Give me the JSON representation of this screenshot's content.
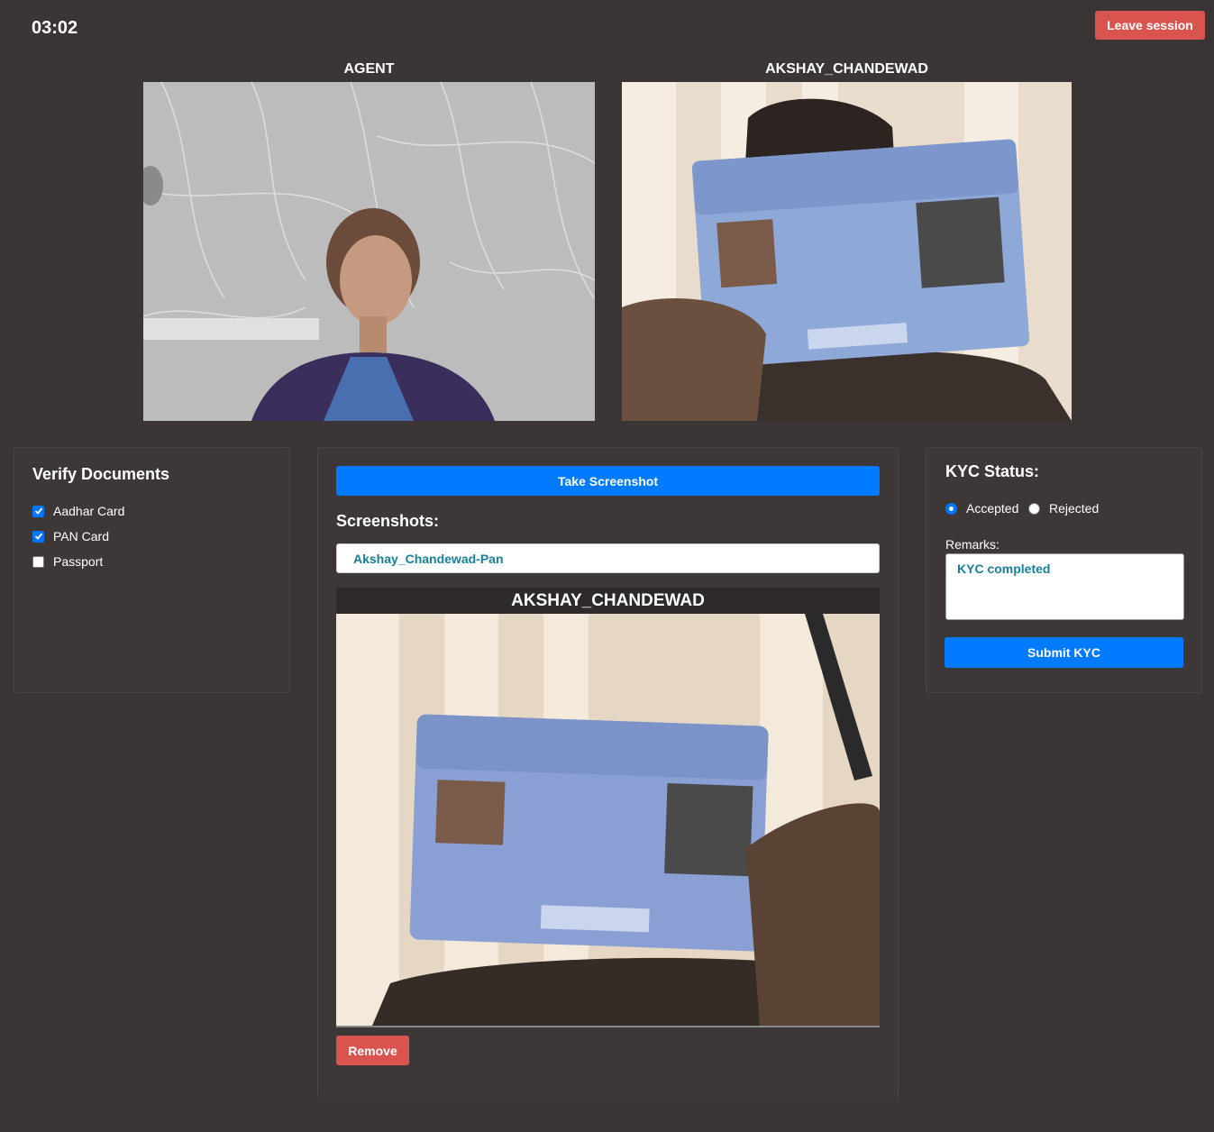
{
  "header": {
    "timer": "03:02",
    "leave_label": "Leave session"
  },
  "videos": {
    "agent_label": "AGENT",
    "customer_label": "AKSHAY_CHANDEWAD"
  },
  "verify": {
    "title": "Verify Documents",
    "items": [
      {
        "label": "Aadhar Card",
        "checked": true
      },
      {
        "label": "PAN Card",
        "checked": true
      },
      {
        "label": "Passport",
        "checked": false
      }
    ]
  },
  "screenshots": {
    "take_label": "Take Screenshot",
    "title": "Screenshots:",
    "item_name": "Akshay_Chandewad-Pan",
    "preview_title": "AKSHAY_CHANDEWAD",
    "remove_label": "Remove"
  },
  "kyc": {
    "title": "KYC Status:",
    "options": [
      {
        "label": "Accepted",
        "selected": true
      },
      {
        "label": "Rejected",
        "selected": false
      }
    ],
    "remarks_label": "Remarks:",
    "remarks_value": "KYC completed",
    "submit_label": "Submit KYC"
  },
  "colors": {
    "background": "#3b3535",
    "primary": "#007bff",
    "danger": "#d9534f",
    "link_text": "#17809a"
  }
}
